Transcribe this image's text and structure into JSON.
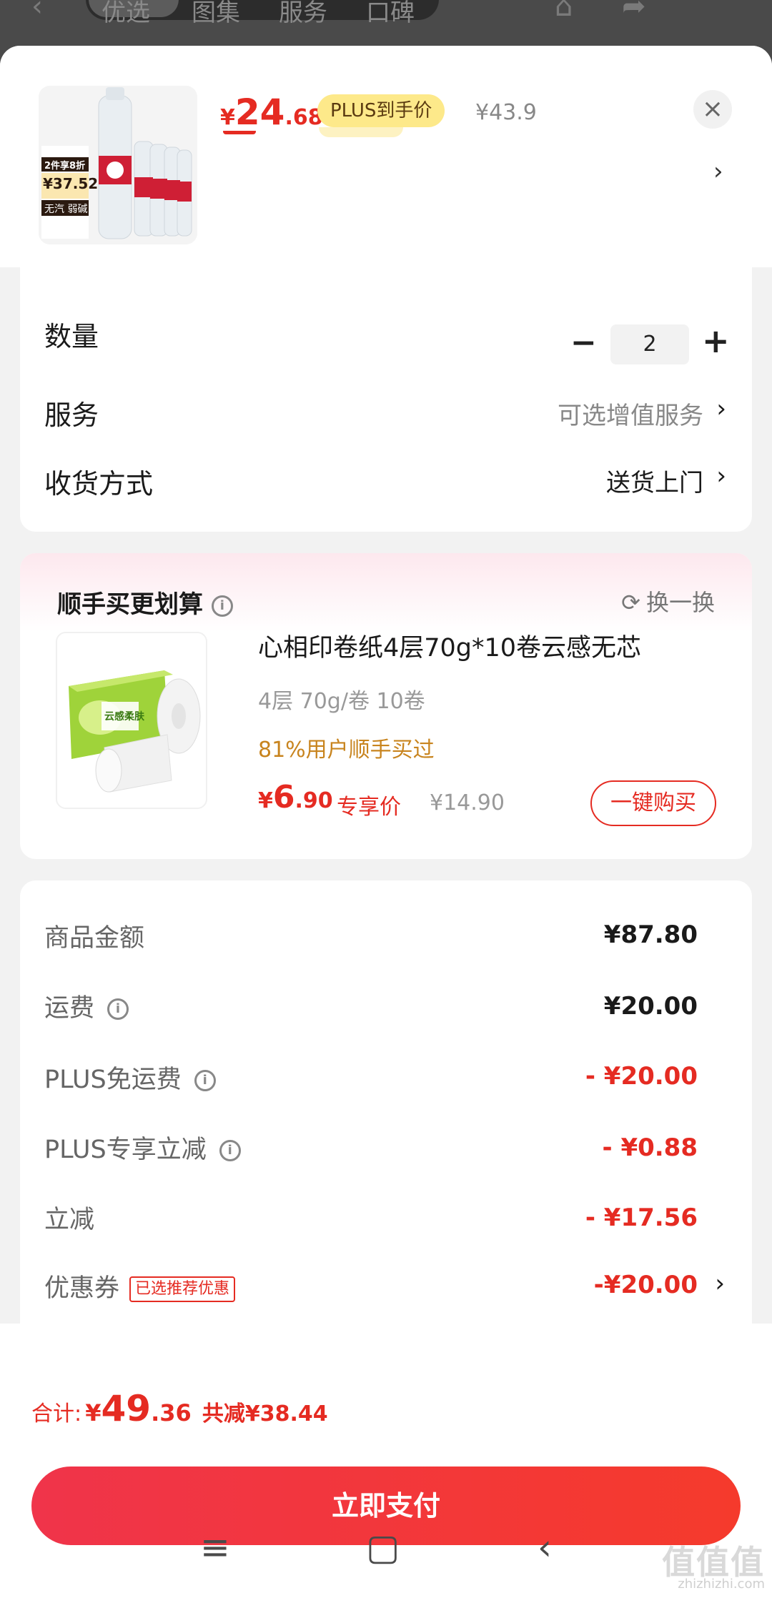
{
  "topbar": {
    "tabs": [
      "优选",
      "图集",
      "服务",
      "口碑"
    ]
  },
  "header": {
    "price_symbol": "¥",
    "price_int": "24",
    "price_dec": ".68",
    "plus_badge": "PLUS到手价",
    "original_price": "¥43.9",
    "close_glyph": "×",
    "chevron": "›"
  },
  "thumb": {
    "promo_top": "2件享8折",
    "promo_price": "¥37.52",
    "promo_tag": "无汽 弱碱"
  },
  "options": {
    "quantity": {
      "label": "数量",
      "minus": "−",
      "value": "2",
      "plus": "+"
    },
    "service": {
      "label": "服务",
      "value": "可选增值服务",
      "chevron": "›"
    },
    "delivery": {
      "label": "收货方式",
      "value": "送货上门",
      "chevron": "›"
    }
  },
  "addon": {
    "title": "顺手买更划算",
    "swap_label": "换一换",
    "product": {
      "title": "心相印卷纸4层70g*10卷云感无芯",
      "spec": "4层 70g/卷 10卷",
      "social": "81%用户顺手买过",
      "price_symbol": "¥",
      "price_int": "6",
      "price_dec": ".90",
      "exclusive_label": "专享价",
      "original_price": "¥14.90",
      "buy_button": "一键购买",
      "package_text": "云感柔肤"
    }
  },
  "fees": [
    {
      "label": "商品金额",
      "value": "¥87.80",
      "highlight": false,
      "info": false
    },
    {
      "label": "运费",
      "value": "¥20.00",
      "highlight": false,
      "info": true
    },
    {
      "label": "PLUS免运费",
      "value": "- ¥20.00",
      "highlight": true,
      "info": true
    },
    {
      "label": "PLUS专享立减",
      "value": "- ¥0.88",
      "highlight": true,
      "info": true
    },
    {
      "label": "立减",
      "value": "- ¥17.56",
      "highlight": true,
      "info": false
    },
    {
      "label": "优惠券",
      "value": "-¥20.00",
      "highlight": true,
      "info": false,
      "tag": "已选推荐优惠",
      "chevron": "›"
    }
  ],
  "footer": {
    "total_label": "合计:",
    "total_symbol": "¥",
    "total_int": "49",
    "total_dec": ".36",
    "saved": "共减¥38.44",
    "pay_button": "立即支付"
  },
  "watermark": {
    "main": "值值值",
    "sub": "zhizhizhi.com"
  },
  "colors": {
    "accent_red": "#e52b22",
    "plus_gold": "#fde98a",
    "social_orange": "#c8841e"
  }
}
